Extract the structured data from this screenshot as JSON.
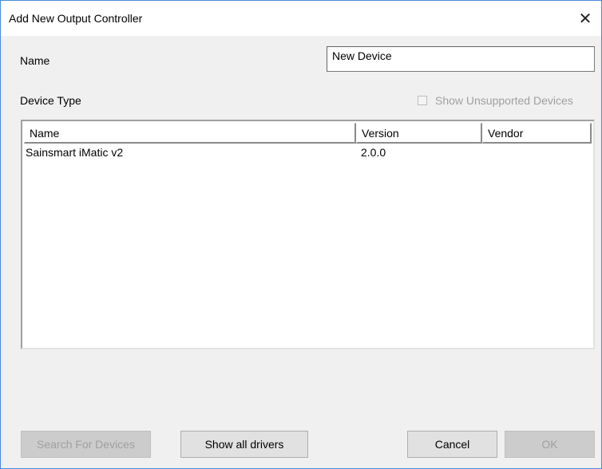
{
  "window": {
    "title": "Add New Output Controller"
  },
  "form": {
    "name_label": "Name",
    "name_value": "New Device",
    "device_type_label": "Device Type",
    "show_unsupported_label": "Show Unsupported Devices",
    "show_unsupported_checked": false
  },
  "table": {
    "columns": [
      "Name",
      "Version",
      "Vendor"
    ],
    "rows": [
      {
        "name": "Sainsmart iMatic v2",
        "version": "2.0.0",
        "vendor": ""
      }
    ]
  },
  "buttons": {
    "search_label": "Search For Devices",
    "show_drivers_label": "Show all drivers",
    "cancel_label": "Cancel",
    "ok_label": "OK"
  },
  "icons": {
    "close": "close-icon"
  }
}
